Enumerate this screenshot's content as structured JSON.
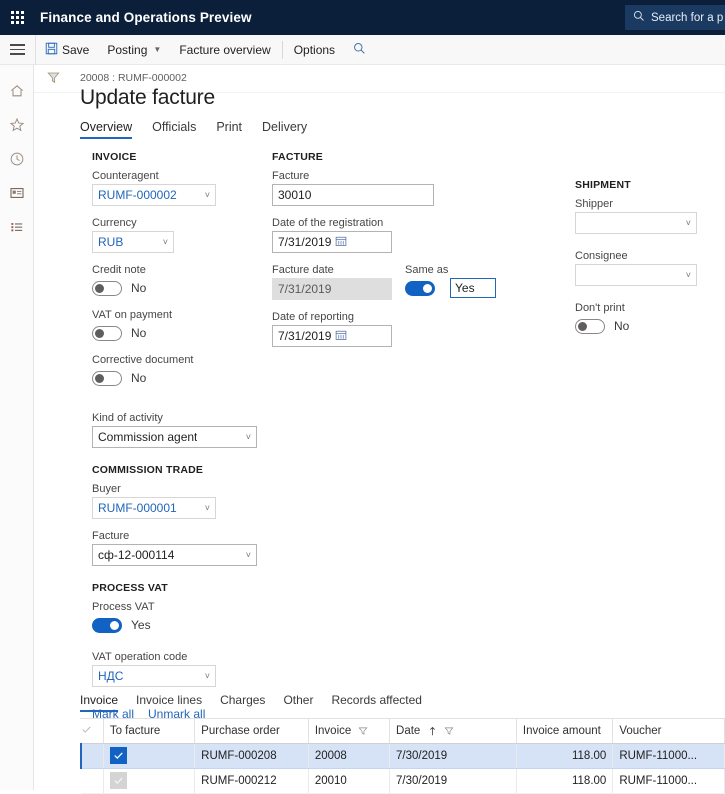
{
  "topbar": {
    "app_title": "Finance and Operations Preview",
    "search_placeholder": "Search for a p",
    "waffle_icon": "app-launcher-icon",
    "search_icon": "search-icon"
  },
  "toolbar": {
    "hamburger_icon": "hamburger-menu-icon",
    "save_label": "Save",
    "save_icon": "save-disk-icon",
    "posting_label": "Posting",
    "facture_overview_label": "Facture overview",
    "options_label": "Options",
    "search_icon": "search-icon"
  },
  "rail": {
    "filter_icon": "filter-funnel-icon",
    "items": [
      {
        "name": "home",
        "icon": "home-icon"
      },
      {
        "name": "favorites",
        "icon": "star-icon"
      },
      {
        "name": "recent",
        "icon": "clock-icon"
      },
      {
        "name": "workspaces",
        "icon": "workspace-icon"
      },
      {
        "name": "modules",
        "icon": "list-icon"
      }
    ]
  },
  "page": {
    "breadcrumb": "20008 : RUMF-000002",
    "title": "Update facture",
    "tabs": [
      {
        "label": "Overview",
        "active": true
      },
      {
        "label": "Officials",
        "active": false
      },
      {
        "label": "Print",
        "active": false
      },
      {
        "label": "Delivery",
        "active": false
      }
    ]
  },
  "invoice": {
    "header": "INVOICE",
    "counteragent": {
      "label": "Counteragent",
      "value": "RUMF-000002"
    },
    "currency": {
      "label": "Currency",
      "value": "RUB"
    },
    "credit_note": {
      "label": "Credit note",
      "value": "No",
      "on": false
    },
    "vat_on_payment": {
      "label": "VAT on payment",
      "value": "No",
      "on": false
    },
    "corrective_document": {
      "label": "Corrective document",
      "value": "No",
      "on": false
    },
    "kind_of_activity": {
      "label": "Kind of activity",
      "value": "Commission agent"
    }
  },
  "facture": {
    "header": "FACTURE",
    "facture": {
      "label": "Facture",
      "value": "30010"
    },
    "date_of_registration": {
      "label": "Date of the registration",
      "value": "7/31/2019"
    },
    "facture_date": {
      "label": "Facture date",
      "value": "7/31/2019"
    },
    "same_as": {
      "label": "Same as",
      "value": "Yes",
      "on": true
    },
    "date_of_reporting": {
      "label": "Date of reporting",
      "value": "7/31/2019"
    },
    "calendar_icon": "calendar-icon"
  },
  "shipment": {
    "header": "SHIPMENT",
    "shipper": {
      "label": "Shipper",
      "value": ""
    },
    "consignee": {
      "label": "Consignee",
      "value": ""
    },
    "dont_print": {
      "label": "Don't print",
      "value": "No",
      "on": false
    }
  },
  "commission_trade": {
    "header": "COMMISSION TRADE",
    "buyer": {
      "label": "Buyer",
      "value": "RUMF-000001"
    },
    "facture": {
      "label": "Facture",
      "value": "сф-12-000114"
    }
  },
  "process_vat": {
    "header": "PROCESS VAT",
    "process_vat": {
      "label": "Process VAT",
      "value": "Yes",
      "on": true
    },
    "vat_operation_code": {
      "label": "VAT operation code",
      "value": "НДС"
    }
  },
  "actions": {
    "mark_all": "Mark all",
    "unmark_all": "Unmark all"
  },
  "lower_tabs": [
    {
      "label": "Invoice",
      "active": true
    },
    {
      "label": "Invoice lines",
      "active": false
    },
    {
      "label": "Charges",
      "active": false
    },
    {
      "label": "Other",
      "active": false
    },
    {
      "label": "Records affected",
      "active": false
    }
  ],
  "grid": {
    "columns": [
      {
        "label": "",
        "key": "check"
      },
      {
        "label": "To facture",
        "key": "to_facture"
      },
      {
        "label": "Purchase order",
        "key": "purchase_order"
      },
      {
        "label": "Invoice",
        "key": "invoice",
        "filter": true
      },
      {
        "label": "Date",
        "key": "date",
        "sort": "asc",
        "filter": true
      },
      {
        "label": "Invoice amount",
        "key": "amount"
      },
      {
        "label": "Voucher",
        "key": "voucher"
      }
    ],
    "rows": [
      {
        "checked": true,
        "selected": true,
        "purchase_order": "RUMF-000208",
        "invoice": "20008",
        "date": "7/30/2019",
        "amount": "118.00",
        "voucher": "RUMF-11000..."
      },
      {
        "checked": false,
        "selected": false,
        "purchase_order": "RUMF-000212",
        "invoice": "20010",
        "date": "7/30/2019",
        "amount": "118.00",
        "voucher": "RUMF-11000..."
      }
    ]
  },
  "colors": {
    "topbar_bg": "#0b1f3a",
    "accent": "#2266bb",
    "toggle_on": "#1262c4",
    "row_selected": "#d6e3f7"
  }
}
